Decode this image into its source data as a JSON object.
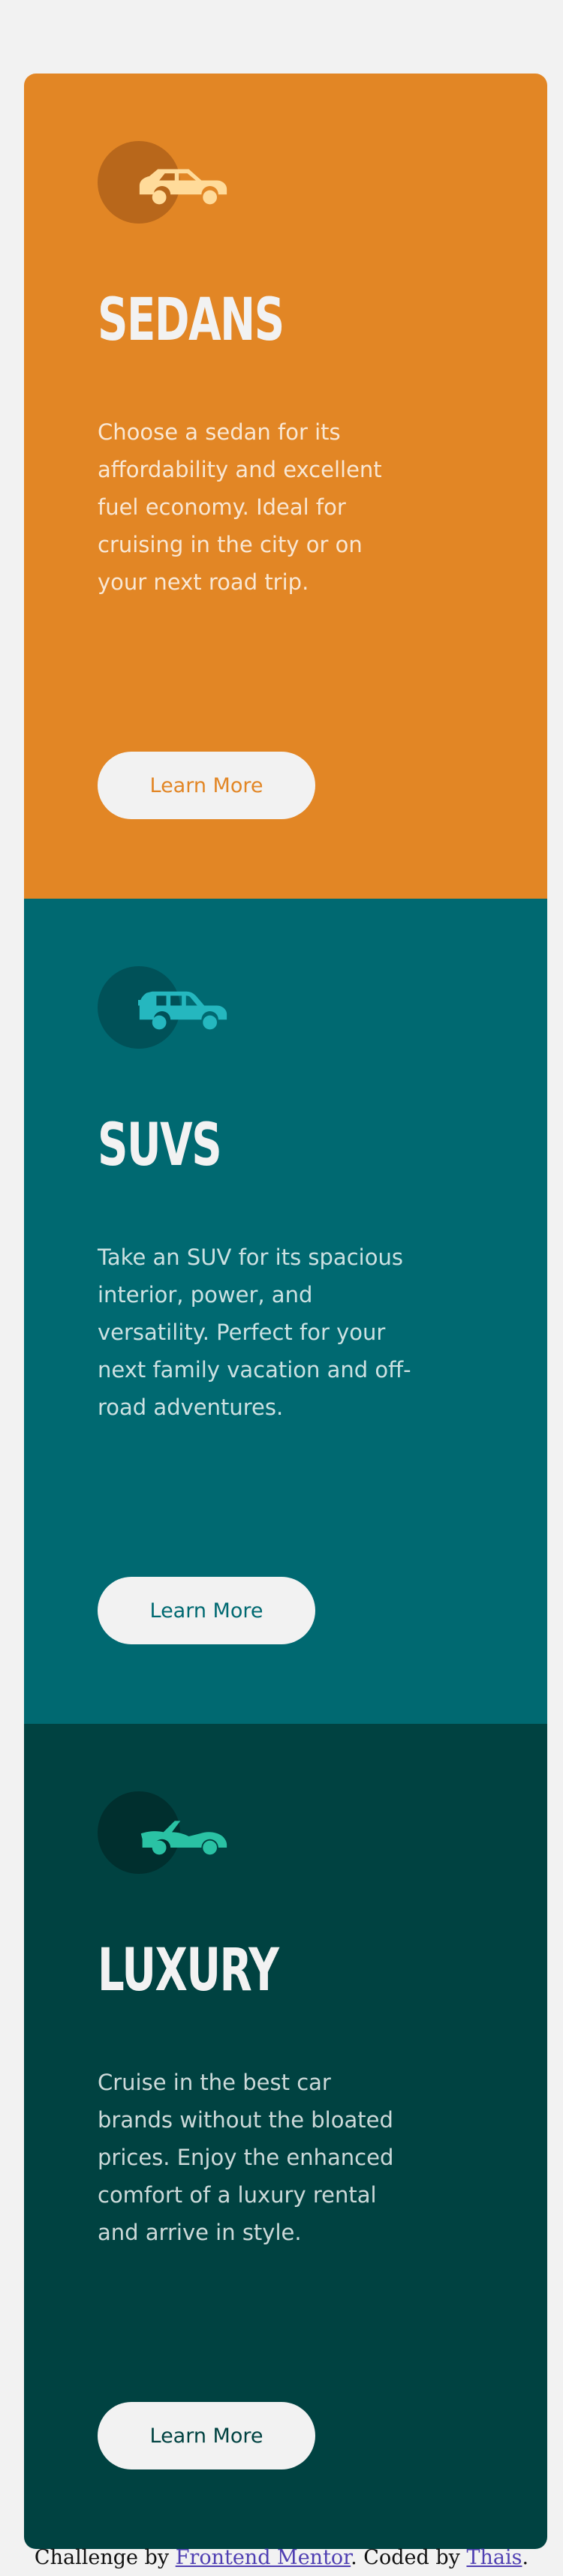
{
  "cards": [
    {
      "id": "sedans",
      "icon": "sedan-car-icon",
      "icon_color": "#ffdb9a",
      "title": "Sedans",
      "text": "Choose a sedan for its affordability and excellent fuel economy. Ideal for cruising in the city or on your next road trip.",
      "button_label": "Learn More",
      "bg_color": "#e28625"
    },
    {
      "id": "suvs",
      "icon": "suv-car-icon",
      "icon_color": "#25b7bf",
      "title": "SUVs",
      "text": "Take an SUV for its spacious interior, power, and versatility. Perfect for your next family vacation and off-road adventures.",
      "button_label": "Learn More",
      "bg_color": "#006971"
    },
    {
      "id": "luxury",
      "icon": "luxury-car-icon",
      "icon_color": "#2ac2a4",
      "title": "Luxury",
      "text": "Cruise in the best car brands without the bloated prices. Enjoy the enhanced comfort of a luxury rental and arrive in style.",
      "button_label": "Learn More",
      "bg_color": "#004241"
    }
  ],
  "attribution": {
    "prefix": "Challenge by",
    "link1": "Frontend Mentor",
    "middle": ". Coded by",
    "link2": "Thais",
    "suffix": "."
  }
}
